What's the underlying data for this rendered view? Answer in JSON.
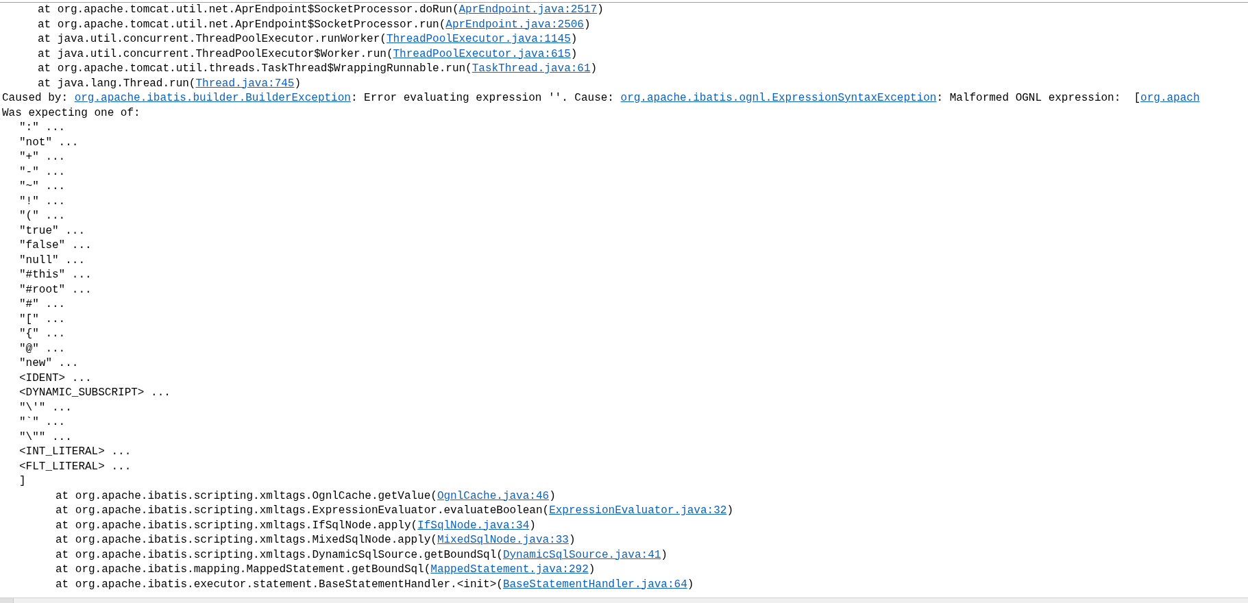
{
  "console_lines": [
    {
      "kind": "frame",
      "parts": [
        {
          "kind": "text",
          "text": "at org.apache.tomcat.util.net.AprEndpoint$SocketProcessor.doRun("
        },
        {
          "kind": "link",
          "text": "AprEndpoint.java:2517"
        },
        {
          "kind": "text",
          "text": ")"
        }
      ]
    },
    {
      "kind": "frame",
      "parts": [
        {
          "kind": "text",
          "text": "at org.apache.tomcat.util.net.AprEndpoint$SocketProcessor.run("
        },
        {
          "kind": "link",
          "text": "AprEndpoint.java:2506"
        },
        {
          "kind": "text",
          "text": ")"
        }
      ]
    },
    {
      "kind": "frame",
      "parts": [
        {
          "kind": "text",
          "text": "at java.util.concurrent.ThreadPoolExecutor.runWorker("
        },
        {
          "kind": "link",
          "text": "ThreadPoolExecutor.java:1145"
        },
        {
          "kind": "text",
          "text": ")"
        }
      ]
    },
    {
      "kind": "frame",
      "parts": [
        {
          "kind": "text",
          "text": "at java.util.concurrent.ThreadPoolExecutor$Worker.run("
        },
        {
          "kind": "link",
          "text": "ThreadPoolExecutor.java:615"
        },
        {
          "kind": "text",
          "text": ")"
        }
      ]
    },
    {
      "kind": "frame",
      "parts": [
        {
          "kind": "text",
          "text": "at org.apache.tomcat.util.threads.TaskThread$WrappingRunnable.run("
        },
        {
          "kind": "link",
          "text": "TaskThread.java:61"
        },
        {
          "kind": "text",
          "text": ")"
        }
      ]
    },
    {
      "kind": "frame",
      "parts": [
        {
          "kind": "text",
          "text": "at java.lang.Thread.run("
        },
        {
          "kind": "link",
          "text": "Thread.java:745"
        },
        {
          "kind": "text",
          "text": ")"
        }
      ]
    },
    {
      "kind": "plain",
      "parts": [
        {
          "kind": "text",
          "text": "Caused by: "
        },
        {
          "kind": "link",
          "text": "org.apache.ibatis.builder.BuilderException"
        },
        {
          "kind": "text",
          "text": ": Error evaluating expression ''. Cause: "
        },
        {
          "kind": "link",
          "text": "org.apache.ibatis.ognl.ExpressionSyntaxException"
        },
        {
          "kind": "text",
          "text": ": Malformed OGNL expression:  ["
        },
        {
          "kind": "link",
          "text": "org.apach"
        }
      ]
    },
    {
      "kind": "plain",
      "parts": [
        {
          "kind": "text",
          "text": "Was expecting one of:"
        }
      ]
    },
    {
      "kind": "option",
      "parts": [
        {
          "kind": "text",
          "text": "\":\" ..."
        }
      ]
    },
    {
      "kind": "option",
      "parts": [
        {
          "kind": "text",
          "text": "\"not\" ..."
        }
      ]
    },
    {
      "kind": "option",
      "parts": [
        {
          "kind": "text",
          "text": "\"+\" ..."
        }
      ]
    },
    {
      "kind": "option",
      "parts": [
        {
          "kind": "text",
          "text": "\"-\" ..."
        }
      ]
    },
    {
      "kind": "option",
      "parts": [
        {
          "kind": "text",
          "text": "\"~\" ..."
        }
      ]
    },
    {
      "kind": "option",
      "parts": [
        {
          "kind": "text",
          "text": "\"!\" ..."
        }
      ]
    },
    {
      "kind": "option",
      "parts": [
        {
          "kind": "text",
          "text": "\"(\" ..."
        }
      ]
    },
    {
      "kind": "option",
      "parts": [
        {
          "kind": "text",
          "text": "\"true\" ..."
        }
      ]
    },
    {
      "kind": "option",
      "parts": [
        {
          "kind": "text",
          "text": "\"false\" ..."
        }
      ]
    },
    {
      "kind": "option",
      "parts": [
        {
          "kind": "text",
          "text": "\"null\" ..."
        }
      ]
    },
    {
      "kind": "option",
      "parts": [
        {
          "kind": "text",
          "text": "\"#this\" ..."
        }
      ]
    },
    {
      "kind": "option",
      "parts": [
        {
          "kind": "text",
          "text": "\"#root\" ..."
        }
      ]
    },
    {
      "kind": "option",
      "parts": [
        {
          "kind": "text",
          "text": "\"#\" ..."
        }
      ]
    },
    {
      "kind": "option",
      "parts": [
        {
          "kind": "text",
          "text": "\"[\" ..."
        }
      ]
    },
    {
      "kind": "option",
      "parts": [
        {
          "kind": "text",
          "text": "\"{\" ..."
        }
      ]
    },
    {
      "kind": "option",
      "parts": [
        {
          "kind": "text",
          "text": "\"@\" ..."
        }
      ]
    },
    {
      "kind": "option",
      "parts": [
        {
          "kind": "text",
          "text": "\"new\" ..."
        }
      ]
    },
    {
      "kind": "option",
      "parts": [
        {
          "kind": "text",
          "text": "<IDENT> ..."
        }
      ]
    },
    {
      "kind": "option",
      "parts": [
        {
          "kind": "text",
          "text": "<DYNAMIC_SUBSCRIPT> ..."
        }
      ]
    },
    {
      "kind": "option",
      "parts": [
        {
          "kind": "text",
          "text": "\"\\'\" ..."
        }
      ]
    },
    {
      "kind": "option",
      "parts": [
        {
          "kind": "text",
          "text": "\"`\" ..."
        }
      ]
    },
    {
      "kind": "option",
      "parts": [
        {
          "kind": "text",
          "text": "\"\\\"\" ..."
        }
      ]
    },
    {
      "kind": "option",
      "parts": [
        {
          "kind": "text",
          "text": "<INT_LITERAL> ..."
        }
      ]
    },
    {
      "kind": "option",
      "parts": [
        {
          "kind": "text",
          "text": "<FLT_LITERAL> ..."
        }
      ]
    },
    {
      "kind": "option",
      "parts": [
        {
          "kind": "text",
          "text": "]"
        }
      ]
    },
    {
      "kind": "nested-frame",
      "parts": [
        {
          "kind": "text",
          "text": "at org.apache.ibatis.scripting.xmltags.OgnlCache.getValue("
        },
        {
          "kind": "link",
          "text": "OgnlCache.java:46"
        },
        {
          "kind": "text",
          "text": ")"
        }
      ]
    },
    {
      "kind": "nested-frame",
      "parts": [
        {
          "kind": "text",
          "text": "at org.apache.ibatis.scripting.xmltags.ExpressionEvaluator.evaluateBoolean("
        },
        {
          "kind": "link",
          "text": "ExpressionEvaluator.java:32"
        },
        {
          "kind": "text",
          "text": ")"
        }
      ]
    },
    {
      "kind": "nested-frame",
      "parts": [
        {
          "kind": "text",
          "text": "at org.apache.ibatis.scripting.xmltags.IfSqlNode.apply("
        },
        {
          "kind": "link",
          "text": "IfSqlNode.java:34"
        },
        {
          "kind": "text",
          "text": ")"
        }
      ]
    },
    {
      "kind": "nested-frame",
      "parts": [
        {
          "kind": "text",
          "text": "at org.apache.ibatis.scripting.xmltags.MixedSqlNode.apply("
        },
        {
          "kind": "link",
          "text": "MixedSqlNode.java:33"
        },
        {
          "kind": "text",
          "text": ")"
        }
      ]
    },
    {
      "kind": "nested-frame",
      "parts": [
        {
          "kind": "text",
          "text": "at org.apache.ibatis.scripting.xmltags.DynamicSqlSource.getBoundSql("
        },
        {
          "kind": "link",
          "text": "DynamicSqlSource.java:41"
        },
        {
          "kind": "text",
          "text": ")"
        }
      ]
    },
    {
      "kind": "nested-frame",
      "parts": [
        {
          "kind": "text",
          "text": "at org.apache.ibatis.mapping.MappedStatement.getBoundSql("
        },
        {
          "kind": "link",
          "text": "MappedStatement.java:292"
        },
        {
          "kind": "text",
          "text": ")"
        }
      ]
    },
    {
      "kind": "nested-frame",
      "parts": [
        {
          "kind": "text",
          "text": "at org.apache.ibatis.executor.statement.BaseStatementHandler.<init>("
        },
        {
          "kind": "link",
          "text": "BaseStatementHandler.java:64"
        },
        {
          "kind": "text",
          "text": ")"
        }
      ]
    }
  ]
}
